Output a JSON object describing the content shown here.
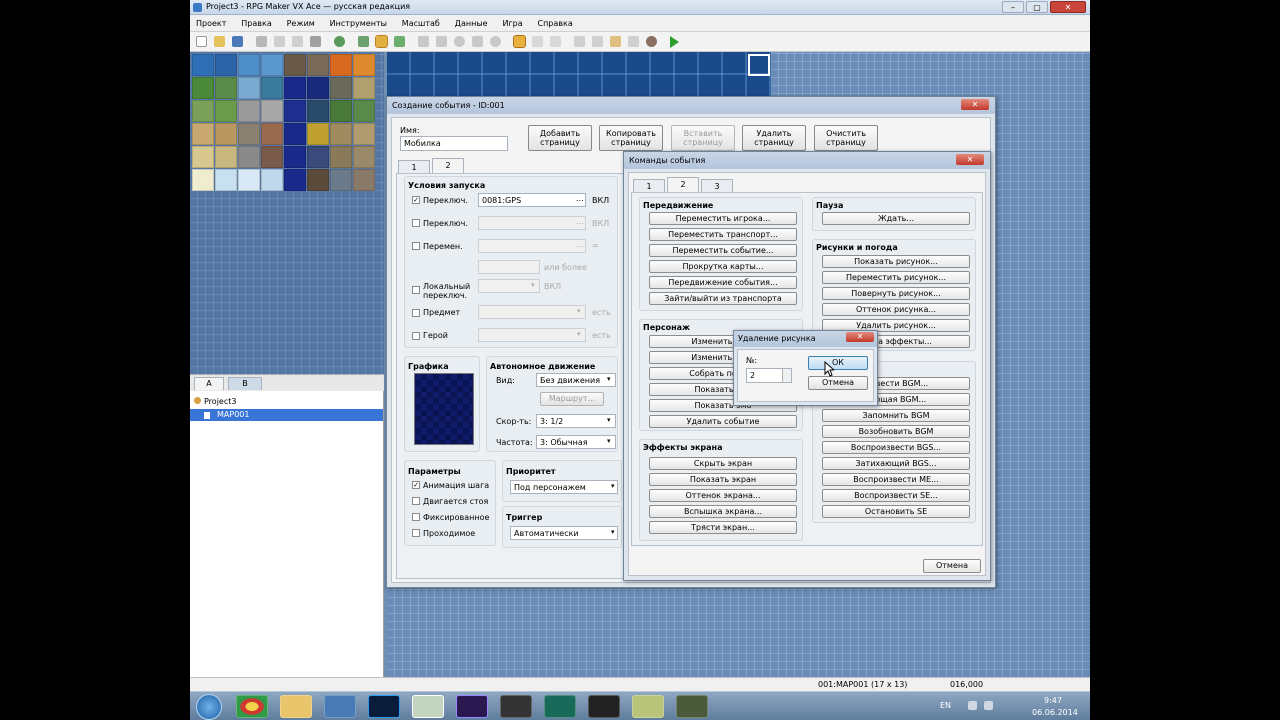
{
  "app": {
    "title": "Project3 - RPG Maker VX Ace — русская редакция",
    "win_buttons": [
      "–",
      "▢",
      "✕"
    ]
  },
  "menu": [
    "Проект",
    "Правка",
    "Режим",
    "Инструменты",
    "Масштаб",
    "Данные",
    "Игра",
    "Справка"
  ],
  "map_tabs": [
    "A",
    "B"
  ],
  "tree": {
    "project": "Project3",
    "map": "MAP001"
  },
  "status": {
    "map": "001:MAP001 (17 x 13)",
    "coords": "016,000"
  },
  "taskbar": {
    "lang": "EN",
    "time": "9:47",
    "date": "06.06.2014"
  },
  "event_dialog": {
    "title": "Создание события - ID:001",
    "close": "✕",
    "name_label": "Имя:",
    "name_value": "Мобилка",
    "buttons": [
      "Добавить страницу",
      "Копировать страницу",
      "Вставить страницу",
      "Удалить страницу",
      "Очистить страницу"
    ],
    "page_tabs": [
      "1",
      "2"
    ],
    "conditions": {
      "title": "Условия запуска",
      "switch1_label": "Переключ.",
      "switch1_value": "0081:GPS",
      "switch1_on": "ВКЛ",
      "switch2_label": "Переключ.",
      "switch2_on": "ВКЛ",
      "var_label": "Перемен.",
      "var_eq": "=",
      "var_ge": "или более",
      "self_label": "Локальный переключ.",
      "self_on": "ВКЛ",
      "item_label": "Предмет",
      "item_have": "есть",
      "actor_label": "Герой",
      "actor_have": "есть",
      "check": "✓",
      "ellipsis": "...",
      "arrow": "▾"
    },
    "graphics_title": "Графика",
    "autonomous": {
      "title": "Автономное движение",
      "type_label": "Вид:",
      "type_value": "Без движения",
      "route_button": "Маршрут...",
      "speed_label": "Скор-ть:",
      "speed_value": "3: 1/2",
      "freq_label": "Частота:",
      "freq_value": "3: Обычная"
    },
    "params": {
      "title": "Параметры",
      "items": [
        "Анимация шага",
        "Двигается стоя",
        "Фиксированное",
        "Проходимое"
      ]
    },
    "priority": {
      "title": "Приоритет",
      "value": "Под персонажем"
    },
    "trigger": {
      "title": "Триггер",
      "value": "Автоматически"
    }
  },
  "commands_dialog": {
    "title": "Команды события",
    "close": "✕",
    "tabs": [
      "1",
      "2",
      "3"
    ],
    "movement": {
      "title": "Передвижение",
      "items": [
        "Переместить игрока...",
        "Переместить транспорт...",
        "Переместить событие...",
        "Прокрутка карты...",
        "Передвижение события...",
        "Зайти/выйти из транспорта"
      ]
    },
    "character": {
      "title": "Персонаж",
      "items": [
        "Изменить проз",
        "Изменить след",
        "Собрать послед",
        "Показать ани",
        "Показать эмо",
        "Удалить событие"
      ]
    },
    "screen": {
      "title": "Эффекты экрана",
      "items": [
        "Скрыть экран",
        "Показать экран",
        "Оттенок экрана...",
        "Вспышка экрана...",
        "Трясти экран..."
      ]
    },
    "pause": {
      "title": "Пауза",
      "items": [
        "Ждать..."
      ]
    },
    "pictures": {
      "title": "Рисунки и погода",
      "items": [
        "Показать рисунок...",
        "Переместить рисунок...",
        "Повернуть рисунок...",
        "Оттенок рисунка...",
        "Удалить рисунок...",
        "...ода эффекты..."
      ]
    },
    "music": {
      "items": [
        "...звести BGM...",
        "...ющая BGM...",
        "Запомнить BGM",
        "Возобновить BGM",
        "Воспроизвести BGS...",
        "Затихающий BGS...",
        "Воспроизвести ME...",
        "Воспроизвести SE...",
        "Остановить SE"
      ]
    },
    "cancel": "Отмена"
  },
  "erase_dialog": {
    "title": "Удаление рисунка",
    "close": "✕",
    "num_label": "№:",
    "num_value": "2",
    "ok": "ОК",
    "cancel": "Отмена"
  }
}
